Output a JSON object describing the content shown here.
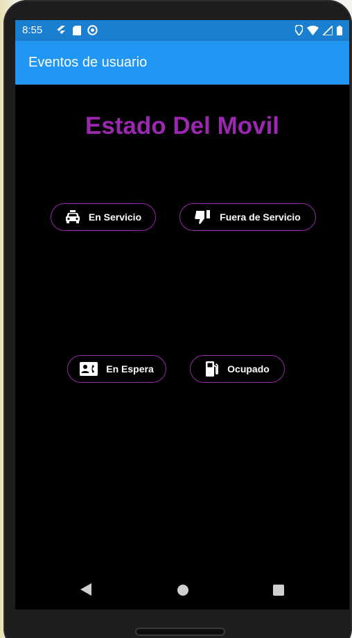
{
  "status_bar": {
    "time": "8:55",
    "left_icons": [
      "flutter-icon",
      "sd-card-icon",
      "at-sign-icon"
    ],
    "right_icons": [
      "location-icon",
      "wifi-icon",
      "signal-icon",
      "battery-icon"
    ]
  },
  "app_bar": {
    "title": "Eventos de usuario",
    "color": "#2196f3"
  },
  "main": {
    "heading": "Estado Del Movil",
    "heading_color": "#9c27b0",
    "buttons": [
      {
        "label": "En Servicio",
        "icon": "taxi-icon"
      },
      {
        "label": "Fuera de Servicio",
        "icon": "thumb-down-icon"
      },
      {
        "label": "En Espera",
        "icon": "contact-phone-icon"
      },
      {
        "label": "Ocupado",
        "icon": "fuel-station-icon"
      }
    ]
  },
  "nav_bar": {
    "buttons": [
      "back-icon",
      "home-icon",
      "recents-icon"
    ]
  }
}
